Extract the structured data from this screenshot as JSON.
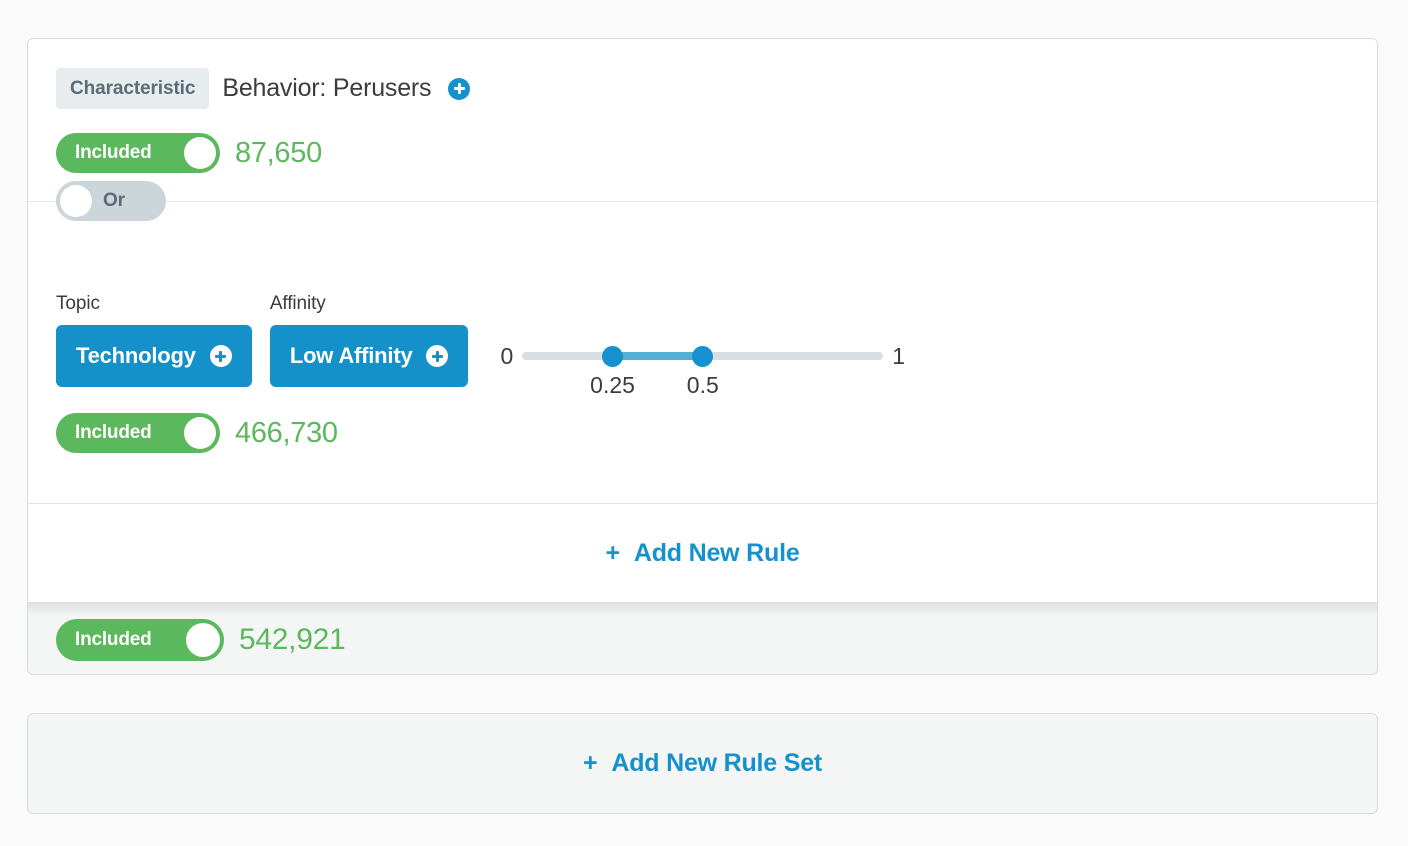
{
  "ruleset": {
    "rules": [
      {
        "tag": "Characteristic",
        "title": "Behavior: Perusers",
        "add_icon": "plus-circle-icon",
        "toggle_label": "Included",
        "count": "87,650"
      },
      {
        "operator": "Or",
        "fields": [
          {
            "label": "Topic",
            "value": "Technology",
            "add_icon": "plus-circle-icon"
          },
          {
            "label": "Affinity",
            "value": "Low Affinity",
            "add_icon": "plus-circle-icon"
          }
        ],
        "slider": {
          "min_label": "0",
          "max_label": "1",
          "low_label": "0.25",
          "high_label": "0.5",
          "min": 0,
          "max": 1,
          "low": 0.25,
          "high": 0.5
        },
        "toggle_label": "Included",
        "count": "466,730"
      }
    ],
    "add_rule": {
      "plus": "+",
      "label": "Add New Rule"
    },
    "total": {
      "toggle_label": "Included",
      "count": "542,921"
    }
  },
  "add_ruleset": {
    "plus": "+",
    "label": "Add New Rule Set"
  },
  "colors": {
    "accent_blue": "#1591cd",
    "chip_blue": "#1491c9",
    "slider_fill": "#55aed4",
    "green": "#5cb85c",
    "tag_bg": "#e7ecef",
    "tag_text": "#5b6b77",
    "or_bg": "#ccd5d9",
    "border": "#d6dde0",
    "page_bg": "#fafafa",
    "footer_bg": "#f4f5f5"
  }
}
